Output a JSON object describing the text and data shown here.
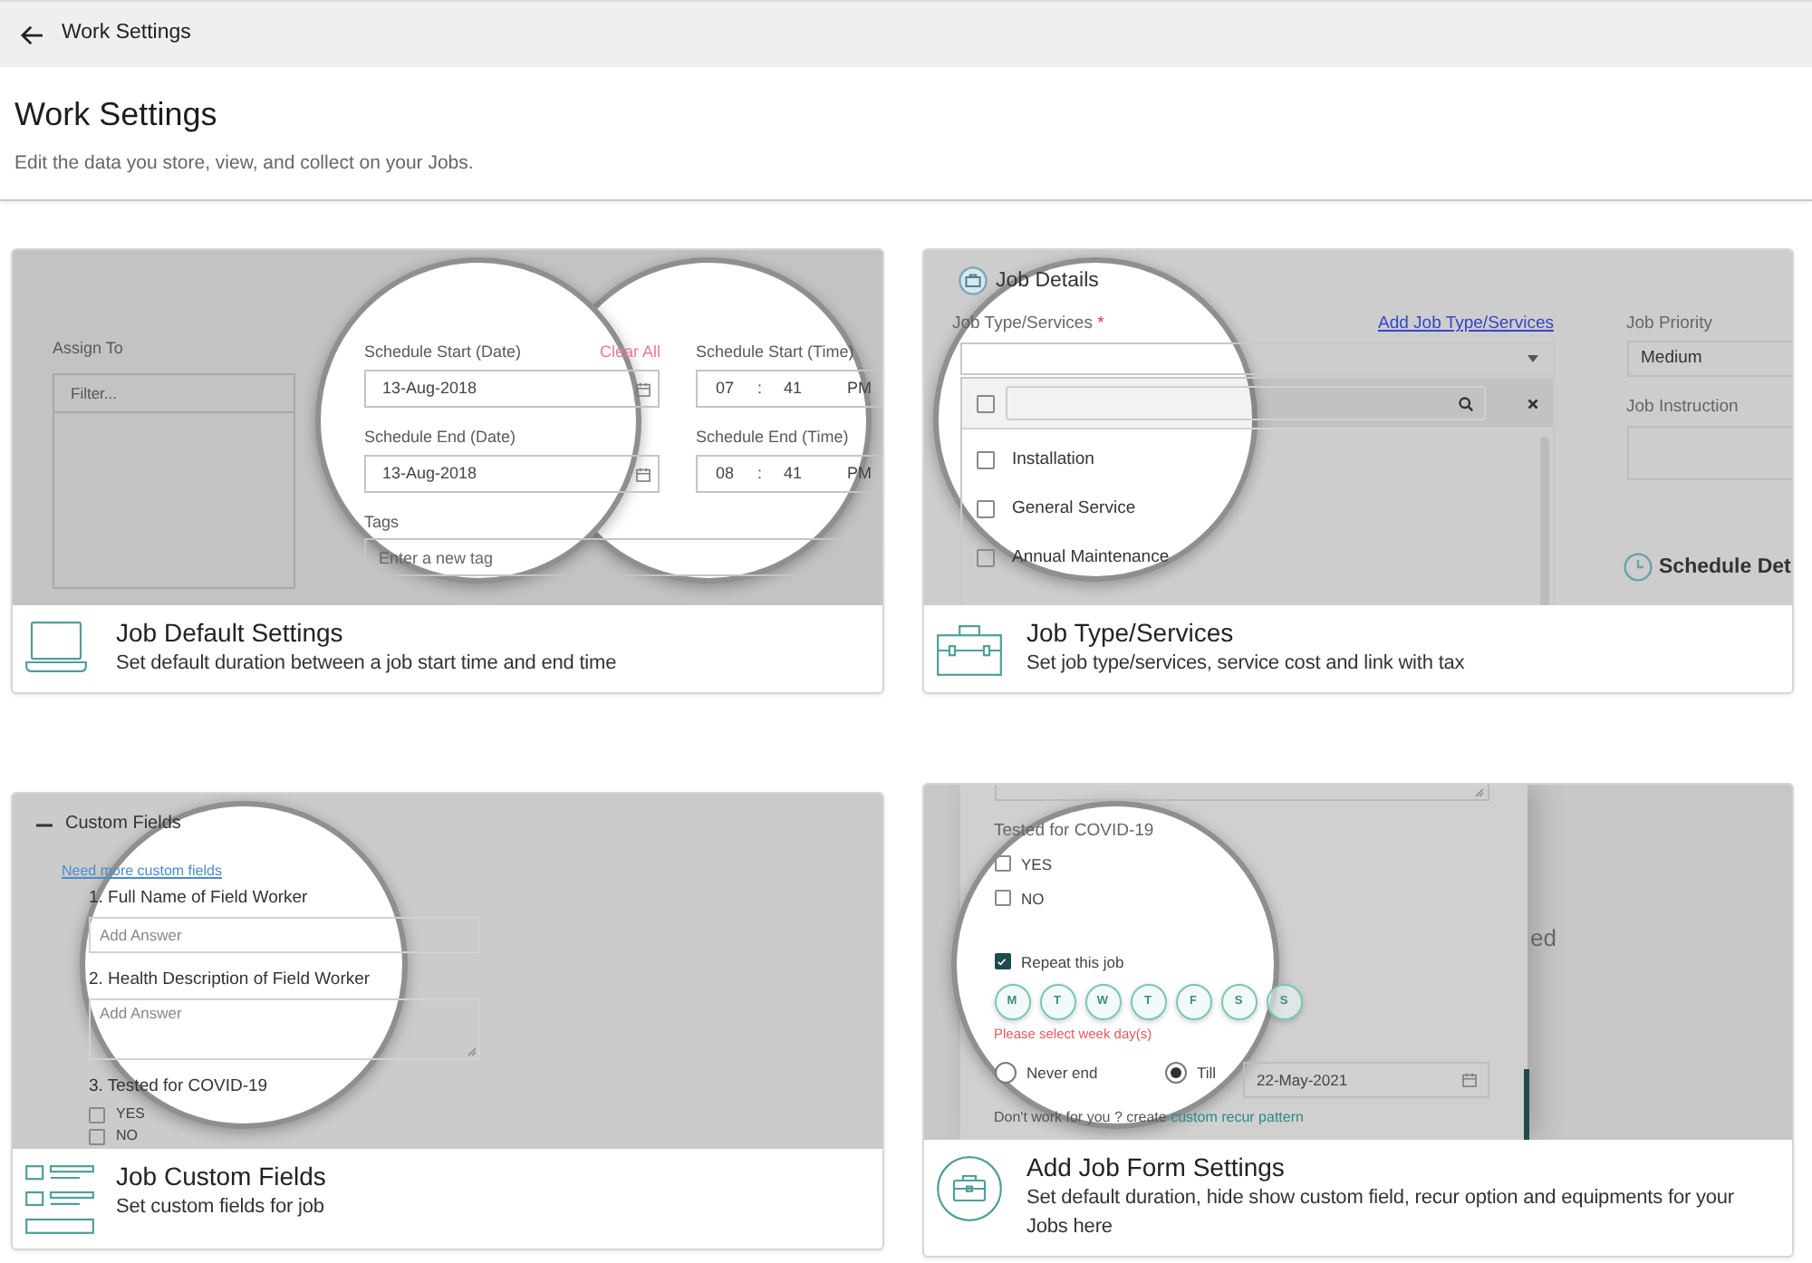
{
  "top_bar": {
    "title": "Work Settings"
  },
  "header": {
    "title": "Work Settings",
    "subtitle": "Edit the data you store, view, and collect on your Jobs."
  },
  "cards": [
    {
      "kind": "defaults",
      "title": "Job Default Settings",
      "description": "Set default duration between a job start time and end time",
      "preview": {
        "assign_to": {
          "label": "Assign To",
          "placeholder": "Filter..."
        },
        "clear_all": "Clear All",
        "start_date": {
          "label": "Schedule Start (Date)",
          "value": "13-Aug-2018"
        },
        "start_time": {
          "label": "Schedule Start (Time)",
          "hour": "07",
          "separator": ":",
          "minute": "41",
          "period": "PM"
        },
        "end_date": {
          "label": "Schedule End (Date)",
          "value": "13-Aug-2018"
        },
        "end_time": {
          "label": "Schedule End (Time)",
          "hour": "08",
          "separator": ":",
          "minute": "41",
          "period": "PM"
        },
        "tags": {
          "label": "Tags",
          "placeholder": "Enter a new tag"
        }
      }
    },
    {
      "kind": "types",
      "title": "Job Type/Services",
      "description": "Set job type/services, service cost and link with tax",
      "preview": {
        "section_title": "Job Details",
        "type_field": {
          "label": "Job Type/Services",
          "required_mark": "*",
          "add_link": "Add Job Type/Services"
        },
        "select_all": {
          "checked": false
        },
        "options": [
          {
            "label": "Installation",
            "checked": false
          },
          {
            "label": "General Service",
            "checked": false
          },
          {
            "label": "Annual Maintenance",
            "checked": false
          }
        ],
        "priority": {
          "label": "Job Priority",
          "value": "Medium"
        },
        "instruction": {
          "label": "Job Instruction"
        },
        "schedule_title": "Schedule Det"
      }
    },
    {
      "kind": "fields",
      "title": "Job Custom Fields",
      "description": "Set custom fields for job",
      "preview": {
        "section": {
          "title": "Custom Fields",
          "expanded": true
        },
        "more_link": "Need more custom fields",
        "questions": [
          {
            "kind": "text",
            "label": "1. Full Name of Field Worker",
            "placeholder": "Add Answer"
          },
          {
            "kind": "textarea",
            "label": "2. Health Description of Field Worker",
            "placeholder": "Add Answer"
          },
          {
            "kind": "checkboxes",
            "label": "3. Tested for COVID-19",
            "options": [
              {
                "label": "YES",
                "checked": false
              },
              {
                "label": "NO",
                "checked": false
              }
            ]
          }
        ]
      }
    },
    {
      "kind": "form",
      "title": "Add Job Form Settings",
      "description": "Set default duration, hide show custom field, recur option and equipments for your Jobs here",
      "preview": {
        "question": {
          "label": "Tested for COVID-19",
          "options": [
            {
              "label": "YES",
              "checked": false
            },
            {
              "label": "NO",
              "checked": false
            }
          ]
        },
        "repeat": {
          "label": "Repeat this job",
          "checked": true
        },
        "weekdays": [
          {
            "label": "M",
            "selected": false
          },
          {
            "label": "T",
            "selected": false
          },
          {
            "label": "W",
            "selected": false
          },
          {
            "label": "T",
            "selected": false
          },
          {
            "label": "F",
            "selected": false
          },
          {
            "label": "S",
            "selected": false
          },
          {
            "label": "S",
            "selected": false
          }
        ],
        "error": "Please select week day(s)",
        "end_options": [
          {
            "label": "Never end",
            "selected": false
          },
          {
            "label": "Till",
            "selected": true
          }
        ],
        "till_date": "22-May-2021",
        "hint": {
          "text": "Don't work for you ? create",
          "link": "custom recur pattern"
        },
        "background_text": "ed"
      }
    }
  ]
}
